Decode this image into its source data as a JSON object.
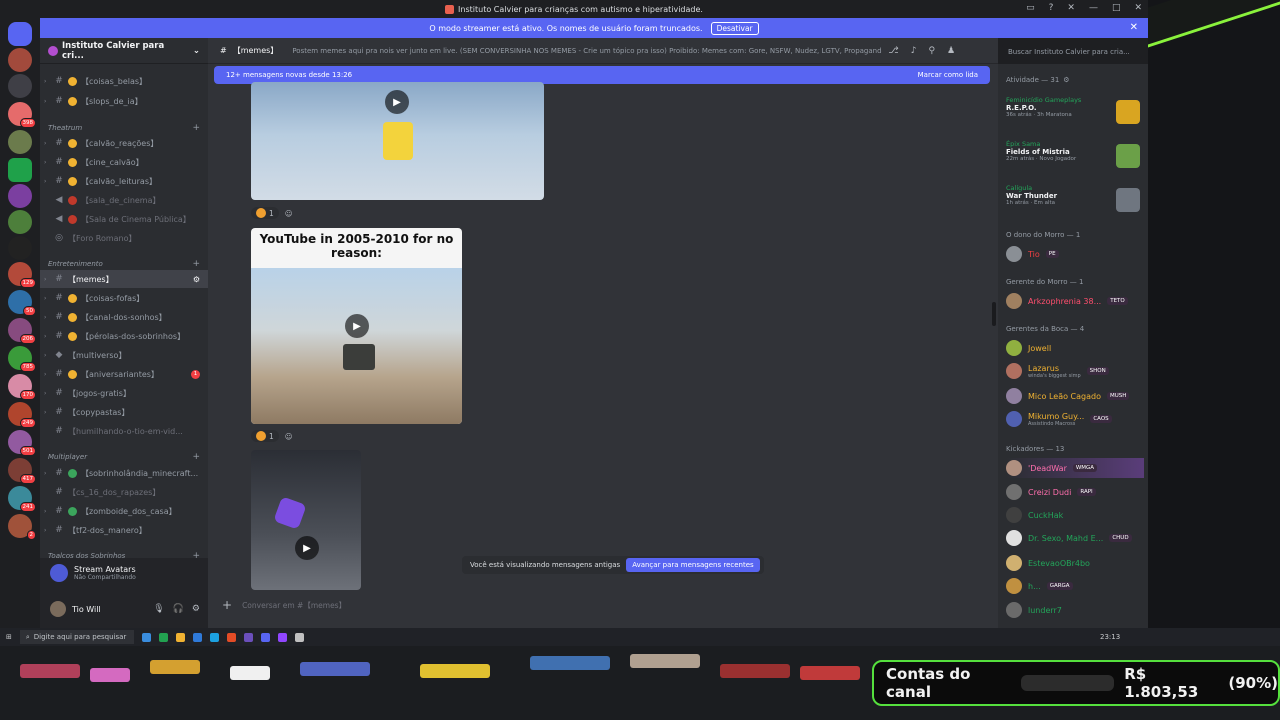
{
  "window": {
    "title": "Instituto Calvier para crianças com autismo e hiperatividade."
  },
  "banner": {
    "text": "O modo streamer está ativo. Os nomes de usuário foram truncados.",
    "button": "Desativar"
  },
  "server": {
    "name": "Instituto Calvier para cri..."
  },
  "categories": {
    "theatrum": "Theatrum",
    "entretenimento": "Entretenimento",
    "multiplayer": "Multiplayer",
    "toalcos": "Toalcos dos Sobrinhos"
  },
  "channels": {
    "c0": "【coisas_belas】",
    "c1": "【slops_de_ia】",
    "c2": "【calvão_reações】",
    "c3": "【cine_calvão】",
    "c4": "【calvão_leituras】",
    "c5": "【sala_de_cinema】",
    "c6": "【Sala de Cinema Pública】",
    "c7": "【Foro Romano】",
    "c8": "【memes】",
    "c9": "【coisas-fofas】",
    "c10": "【canal-dos-sonhos】",
    "c11": "【pérolas-dos-sobrinhos】",
    "c12": "【multiverso】",
    "c13": "【aniversariantes】",
    "c14": "【jogos-gratis】",
    "c15": "【copypastas】",
    "c16": "【humilhando-o-tio-em-vid...",
    "c17": "【sobrinholândia_minecraft...",
    "c18": "【cs_16_dos_rapazes】",
    "c19": "【zomboide_dos_casa】",
    "c20": "【tf2-dos_manero】"
  },
  "user_panel": {
    "stream_title": "Stream Avatars",
    "stream_sub": "Não Compartilhando",
    "username": "Tio Will"
  },
  "channel_header": {
    "name": "【memes】",
    "topic": "Postem memes aqui pra nois ver junto em live. (SEM CONVERSINHA NOS MEMES - Crie um tópico pra isso) Proibido: Memes com: Gore, NSFW, Nudez, LGTV, Propaganda de...",
    "search_placeholder": "Buscar Instituto Calvier para cria..."
  },
  "new_messages": {
    "text": "12+ mensagens novas desde 13:26",
    "action": "Marcar como lida"
  },
  "posts": {
    "img2_caption": "YouTube in 2005-2010 for no reason:",
    "reaction_count_1": "1",
    "reaction_count_2": "1"
  },
  "old_messages": {
    "text": "Você está visualizando mensagens antigas",
    "button": "Avançar para mensagens recentes"
  },
  "composer": {
    "placeholder": "Conversar em #【memes】"
  },
  "members": {
    "activity_header": "Atividade — 31",
    "activities": [
      {
        "name": "Feminicídio Gameplays",
        "game": "R.E.P.O.",
        "meta": "36s atrás · 3h Maratona"
      },
      {
        "name": "Épix Sama",
        "game": "Fields of Mistria",
        "meta": "22m atrás · Novo Jogador"
      },
      {
        "name": "Calígula",
        "game": "War Thunder",
        "meta": "1h atrás · Em alta"
      }
    ],
    "groups": [
      {
        "title": "O dono do Morro — 1",
        "members": [
          {
            "name": "Tio",
            "tag": "PE",
            "color": "#f23f43"
          }
        ]
      },
      {
        "title": "Gerente do Morro — 1",
        "members": [
          {
            "name": "Arkzophrenia 38...",
            "tag": "TETO",
            "color": "#ff4f6e"
          }
        ]
      },
      {
        "title": "Gerentes da Boca — 4",
        "members": [
          {
            "name": "Jowell",
            "tag": "",
            "color": "#f0b232"
          },
          {
            "name": "Lazarus",
            "tag": "SHON",
            "color": "#f0b232",
            "sub": "winda's biggest simp"
          },
          {
            "name": "Mico Leão Cagado",
            "tag": "MUSH",
            "color": "#f0b232"
          },
          {
            "name": "Mikumo Guy...",
            "tag": "CAOS",
            "color": "#f0b232",
            "sub": "Assistindo Macross"
          }
        ]
      },
      {
        "title": "Kickadores — 13",
        "members": [
          {
            "name": "'DeadWar",
            "tag": "WMGA",
            "color": "#ff6fae"
          },
          {
            "name": "Creizi Dudi",
            "tag": "RAPI",
            "color": "#ff6fae"
          },
          {
            "name": "CuckHak",
            "tag": "",
            "color": "#23a55a"
          },
          {
            "name": "Dr. Sexo, Mahd E...",
            "tag": "CHUD",
            "color": "#23a55a"
          },
          {
            "name": "EstevaoOBr4bo",
            "tag": "",
            "color": "#23a55a"
          },
          {
            "name": "h...",
            "tag": "GARGA",
            "color": "#23a55a"
          },
          {
            "name": "lunderr7",
            "tag": "",
            "color": "#23a55a"
          }
        ]
      }
    ]
  },
  "taskbar": {
    "search": "Digite aqui para pesquisar",
    "time": "23:13"
  },
  "goal": {
    "label": "Contas do canal",
    "amount": "R$ 1.803,53",
    "percent_text": "(90%)",
    "progress": 0.9
  },
  "colors": {
    "accent": "#5865f2",
    "goal_green": "#4cdc2c"
  }
}
